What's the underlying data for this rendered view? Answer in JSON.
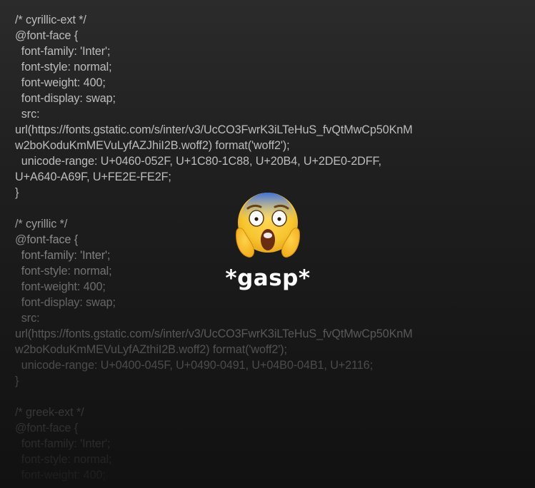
{
  "code_lines": [
    "/* cyrillic-ext */",
    "@font-face {",
    "  font-family: 'Inter';",
    "  font-style: normal;",
    "  font-weight: 400;",
    "  font-display: swap;",
    "  src:",
    "url(https://fonts.gstatic.com/s/inter/v3/UcCO3FwrK3iLTeHuS_fvQtMwCp50KnM",
    "w2boKoduKmMEVuLyfAZJhiI2B.woff2) format('woff2');",
    "  unicode-range: U+0460-052F, U+1C80-1C88, U+20B4, U+2DE0-2DFF,",
    "U+A640-A69F, U+FE2E-FE2F;",
    "}",
    "",
    "/* cyrillic */",
    "@font-face {",
    "  font-family: 'Inter';",
    "  font-style: normal;",
    "  font-weight: 400;",
    "  font-display: swap;",
    "  src:",
    "url(https://fonts.gstatic.com/s/inter/v3/UcCO3FwrK3iLTeHuS_fvQtMwCp50KnM",
    "w2boKoduKmMEVuLyfAZthiI2B.woff2) format('woff2');",
    "  unicode-range: U+0400-045F, U+0490-0491, U+04B0-04B1, U+2116;",
    "}",
    "",
    "/* greek-ext */",
    "@font-face {",
    "  font-family: 'Inter';",
    "  font-style: normal;",
    "  font-weight: 400;"
  ],
  "reaction": {
    "emoji_icon": "face-screaming-in-fear-icon",
    "caption": "*gasp*"
  },
  "colors": {
    "code_text": "#bdbdbd",
    "caption_text": "#ffffff",
    "emoji_face": "#f7c52f"
  }
}
